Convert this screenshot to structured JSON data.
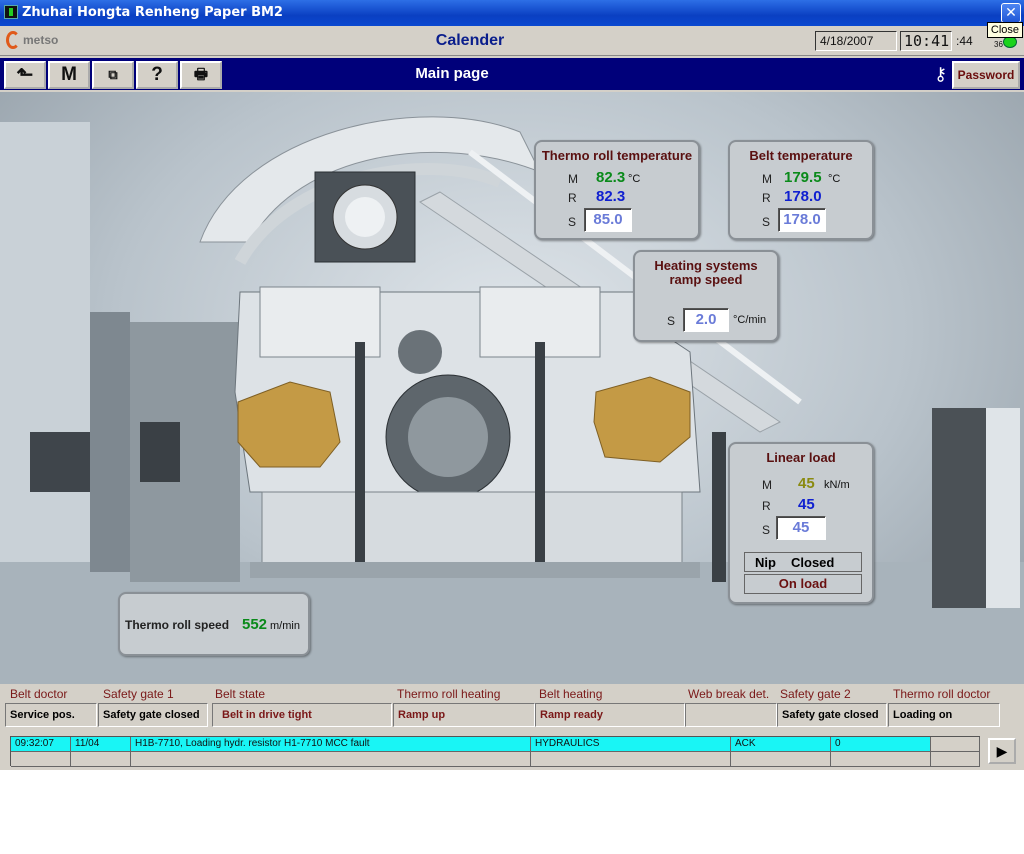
{
  "window": {
    "title": "Zhuhai Hongta Renheng Paper BM2",
    "close_tooltip": "Close",
    "close_symbol": "✕"
  },
  "header": {
    "logo": "metso",
    "area": "Calender",
    "date": "4/18/2007",
    "time": "10:41",
    "seconds": ":44",
    "small_number": "36"
  },
  "toolbar": {
    "back_symbol": "⬑",
    "m_label": "M",
    "network_symbol": "⧉",
    "help_label": "?",
    "print_symbol": "🖶",
    "page_title": "Main page",
    "key_symbol": "⚷",
    "password_label": "Password"
  },
  "thermo_roll_temperature": {
    "title": "Thermo roll temperature",
    "m_label": "M",
    "m_value": "82.3",
    "unit": "°C",
    "r_label": "R",
    "r_value": "82.3",
    "s_label": "S",
    "s_value": "85.0"
  },
  "belt_temperature": {
    "title": "Belt temperature",
    "m_label": "M",
    "m_value": "179.5",
    "unit": "°C",
    "r_label": "R",
    "r_value": "178.0",
    "s_label": "S",
    "s_value": "178.0"
  },
  "heating_ramp": {
    "title_line1": "Heating systems",
    "title_line2": "ramp speed",
    "s_label": "S",
    "s_value": "2.0",
    "unit": "°C/min"
  },
  "linear_load": {
    "title": "Linear load",
    "m_label": "M",
    "m_value": "45",
    "unit": "kN/m",
    "r_label": "R",
    "r_value": "45",
    "s_label": "S",
    "s_value": "45",
    "nip_label": "Nip",
    "nip_state": "Closed",
    "load_state": "On load"
  },
  "thermo_roll_speed": {
    "label": "Thermo roll speed",
    "value": "552",
    "unit": "m/min"
  },
  "status": [
    {
      "label": "Belt doctor",
      "value": "Service pos."
    },
    {
      "label": "Safety gate 1",
      "value": "Safety gate closed"
    },
    {
      "label": "Belt state",
      "value": "Belt in drive tight"
    },
    {
      "label": "Thermo roll heating",
      "value": "Ramp up"
    },
    {
      "label": "Belt heating",
      "value": "Ramp ready"
    },
    {
      "label": "Web break det.",
      "value": ""
    },
    {
      "label": "Safety gate 2",
      "value": "Safety gate closed"
    },
    {
      "label": "Thermo roll doctor",
      "value": "Loading on"
    }
  ],
  "alarm": {
    "time": "09:32:07",
    "date": "11/04",
    "text": "H1B-7710, Loading hydr. resistor H1-7710 MCC fault",
    "group": "HYDRAULICS",
    "state": "ACK",
    "count": "0",
    "next_symbol": "▶"
  },
  "colors": {
    "title_bar": "#0a3fc2",
    "toolbar": "#00007a",
    "alarm_active": "#19f5f5",
    "measured": "#0a8a1a",
    "reference": "#1020d0",
    "setpoint": "#6a7bd8",
    "label": "#7a1818"
  }
}
